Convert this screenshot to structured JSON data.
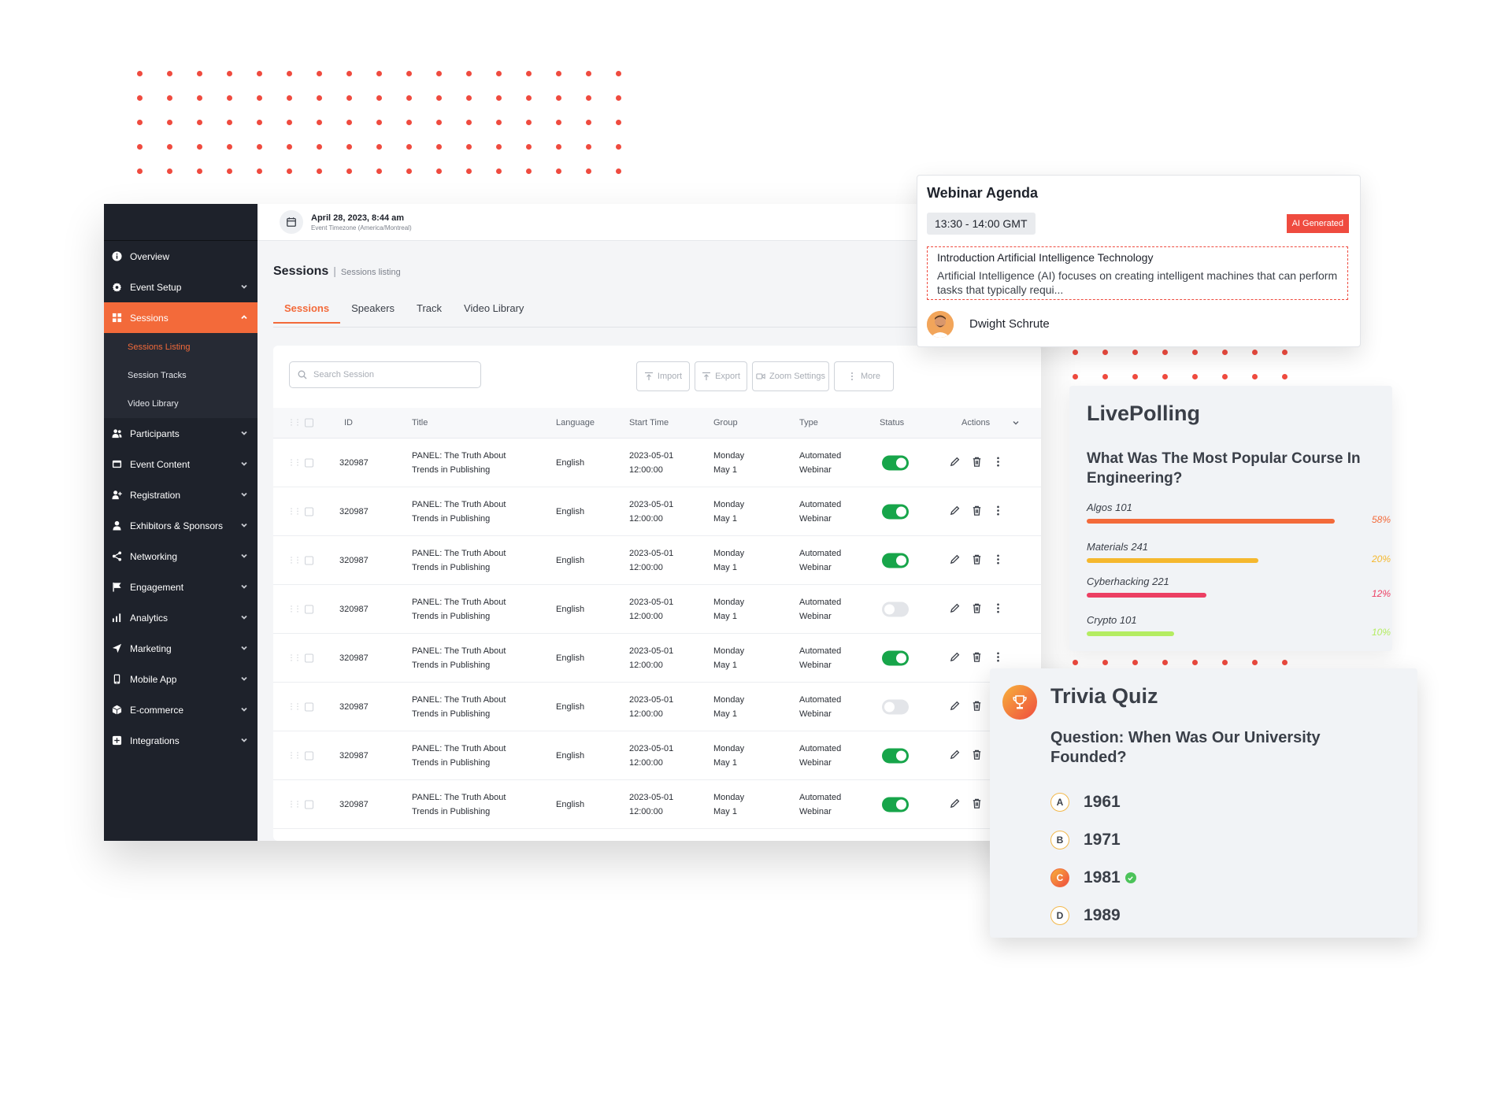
{
  "colors": {
    "accent": "#f36a3a",
    "sidebar": "#1e222b",
    "toggle_on": "#17a54a",
    "dots": "#ef4b3f"
  },
  "header": {
    "date": "April 28, 2023, 8:44 am",
    "timezone": "Event Timezone (America/Montreal)"
  },
  "sidebar": {
    "items": [
      {
        "label": "Overview",
        "icon": "info-icon"
      },
      {
        "label": "Event Setup",
        "icon": "gear-icon"
      },
      {
        "label": "Sessions",
        "icon": "grid-icon"
      },
      {
        "label": "Participants",
        "icon": "people-icon"
      },
      {
        "label": "Event Content",
        "icon": "content-icon"
      },
      {
        "label": "Registration",
        "icon": "user-plus-icon"
      },
      {
        "label": "Exhibitors & Sponsors",
        "icon": "person-icon"
      },
      {
        "label": "Networking",
        "icon": "share-icon"
      },
      {
        "label": "Engagement",
        "icon": "flag-icon"
      },
      {
        "label": "Analytics",
        "icon": "bar-chart-icon"
      },
      {
        "label": "Marketing",
        "icon": "send-icon"
      },
      {
        "label": "Mobile App",
        "icon": "mobile-icon"
      },
      {
        "label": "E-commerce",
        "icon": "box-icon"
      },
      {
        "label": "Integrations",
        "icon": "plus-square-icon"
      }
    ],
    "sub_items": [
      "Sessions Listing",
      "Session Tracks",
      "Video Library"
    ]
  },
  "page": {
    "title": "Sessions",
    "subtitle": "Sessions listing"
  },
  "tabs": [
    "Sessions",
    "Speakers",
    "Track",
    "Video Library"
  ],
  "toolbar": {
    "search_placeholder": "Search Session",
    "import": "Import",
    "export": "Export",
    "zoom": "Zoom Settings",
    "more": "More"
  },
  "table": {
    "headers": [
      "ID",
      "Title",
      "Language",
      "Start Time",
      "Group",
      "Type",
      "Status",
      "Actions"
    ],
    "rows": [
      {
        "id": "320987",
        "title1": "PANEL: The Truth About",
        "title2": "Trends in Publishing",
        "language": "English",
        "date": "2023-05-01",
        "time": "12:00:00",
        "group1": "Monday",
        "group2": "May 1",
        "type1": "Automated",
        "type2": "Webinar",
        "status": true
      },
      {
        "id": "320987",
        "title1": "PANEL: The Truth About",
        "title2": "Trends in Publishing",
        "language": "English",
        "date": "2023-05-01",
        "time": "12:00:00",
        "group1": "Monday",
        "group2": "May 1",
        "type1": "Automated",
        "type2": "Webinar",
        "status": true
      },
      {
        "id": "320987",
        "title1": "PANEL: The Truth About",
        "title2": "Trends in Publishing",
        "language": "English",
        "date": "2023-05-01",
        "time": "12:00:00",
        "group1": "Monday",
        "group2": "May 1",
        "type1": "Automated",
        "type2": "Webinar",
        "status": true
      },
      {
        "id": "320987",
        "title1": "PANEL: The Truth About",
        "title2": "Trends in Publishing",
        "language": "English",
        "date": "2023-05-01",
        "time": "12:00:00",
        "group1": "Monday",
        "group2": "May 1",
        "type1": "Automated",
        "type2": "Webinar",
        "status": false
      },
      {
        "id": "320987",
        "title1": "PANEL: The Truth About",
        "title2": "Trends in Publishing",
        "language": "English",
        "date": "2023-05-01",
        "time": "12:00:00",
        "group1": "Monday",
        "group2": "May 1",
        "type1": "Automated",
        "type2": "Webinar",
        "status": true
      },
      {
        "id": "320987",
        "title1": "PANEL: The Truth About",
        "title2": "Trends in Publishing",
        "language": "English",
        "date": "2023-05-01",
        "time": "12:00:00",
        "group1": "Monday",
        "group2": "May 1",
        "type1": "Automated",
        "type2": "Webinar",
        "status": false
      },
      {
        "id": "320987",
        "title1": "PANEL: The Truth About",
        "title2": "Trends in Publishing",
        "language": "English",
        "date": "2023-05-01",
        "time": "12:00:00",
        "group1": "Monday",
        "group2": "May 1",
        "type1": "Automated",
        "type2": "Webinar",
        "status": true
      },
      {
        "id": "320987",
        "title1": "PANEL: The Truth About",
        "title2": "Trends in Publishing",
        "language": "English",
        "date": "2023-05-01",
        "time": "12:00:00",
        "group1": "Monday",
        "group2": "May 1",
        "type1": "Automated",
        "type2": "Webinar",
        "status": true
      }
    ]
  },
  "agenda": {
    "title": "Webinar Agenda",
    "time": "13:30 - 14:00 GMT",
    "badge": "AI Generated",
    "session_title": "Introduction Artificial Intelligence Technology",
    "description": "Artificial Intelligence (AI) focuses on creating intelligent machines that can perform tasks that typically requi...",
    "speaker": "Dwight Schrute"
  },
  "poll": {
    "title": "LivePolling",
    "question": "What Was The Most Popular Course In Engineering?",
    "options": [
      {
        "label": "Algos 101",
        "percent": "58%",
        "fraction": 0.85,
        "color": "#f36a3a"
      },
      {
        "label": "Materials 241",
        "percent": "20%",
        "fraction": 0.59,
        "color": "#f5b82e"
      },
      {
        "label": "Cyberhacking 221",
        "percent": "12%",
        "fraction": 0.41,
        "color": "#ec3f63"
      },
      {
        "label": "Crypto 101",
        "percent": "10%",
        "fraction": 0.3,
        "color": "#b4ec62"
      }
    ]
  },
  "quiz": {
    "title": "Trivia Quiz",
    "question": "Question: When Was Our University Founded?",
    "options": [
      {
        "letter": "A",
        "value": "1961",
        "correct": false
      },
      {
        "letter": "B",
        "value": "1971",
        "correct": false
      },
      {
        "letter": "C",
        "value": "1981",
        "correct": true
      },
      {
        "letter": "D",
        "value": "1989",
        "correct": false
      }
    ]
  }
}
